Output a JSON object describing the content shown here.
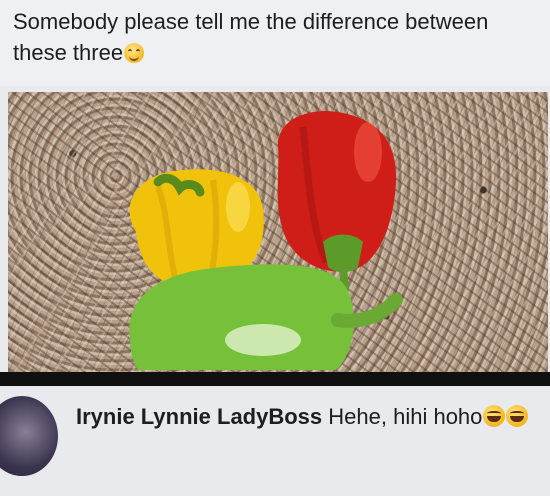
{
  "post": {
    "text": "Somebody please tell me the difference between these three",
    "emoji": "smiling-face-icon"
  },
  "image": {
    "description_icon": "peppers-photo",
    "colors": {
      "yellow": "#f2c40f",
      "red": "#d11f1a",
      "green": "#79c23a",
      "counter": "#a68f78"
    }
  },
  "comment": {
    "author": "Irynie Lynnie LadyBoss",
    "text": "Hehe, hihi hoho",
    "emojis": [
      "laughing-face-icon",
      "laughing-face-icon"
    ]
  }
}
